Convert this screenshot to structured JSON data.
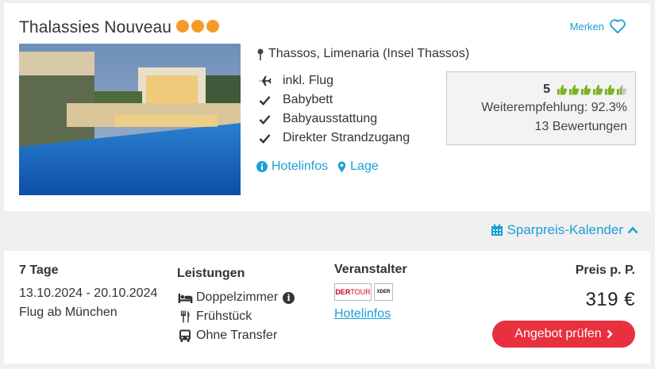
{
  "hotel": {
    "name": "Thalassies Nouveau",
    "stars": 3,
    "merken_label": "Merken",
    "location": "Thassos, Limenaria (Insel Thassos)",
    "features": [
      "inkl. Flug",
      "Babybett",
      "Babyausstattung",
      "Direkter Strandzugang"
    ],
    "feature_icons": [
      "plane-icon",
      "check-icon",
      "check-icon",
      "check-icon"
    ],
    "links": {
      "hotelinfos": "Hotelinfos",
      "lage": "Lage"
    }
  },
  "rating": {
    "score": "5",
    "thumbs_filled": 5.5,
    "thumbs_total": 6,
    "recommendation": "Weiterempfehlung: 92.3%",
    "reviews": "13 Bewertungen"
  },
  "sparpreis": {
    "label": "Sparpreis-Kalender"
  },
  "offer": {
    "duration": "7 Tage",
    "dates": "13.10.2024 - 20.10.2024",
    "flight": "Flug ab München",
    "leistungen_title": "Leistungen",
    "room": "Doppelzimmer",
    "board": "Frühstück",
    "transfer": "Ohne Transfer",
    "veranstalter_title": "Veranstalter",
    "operator_logo_1": {
      "a": "DER",
      "b": "TOUR"
    },
    "operator_logo_2": "XDER",
    "veranstalter_link": "Hotelinfos",
    "price_title": "Preis p. P.",
    "price": "319 €",
    "cta_label": "Angebot prüfen"
  },
  "colors": {
    "accent": "#1ca0d6",
    "star": "#f39c2b",
    "thumb": "#7ab51d",
    "cta": "#e8303f"
  }
}
